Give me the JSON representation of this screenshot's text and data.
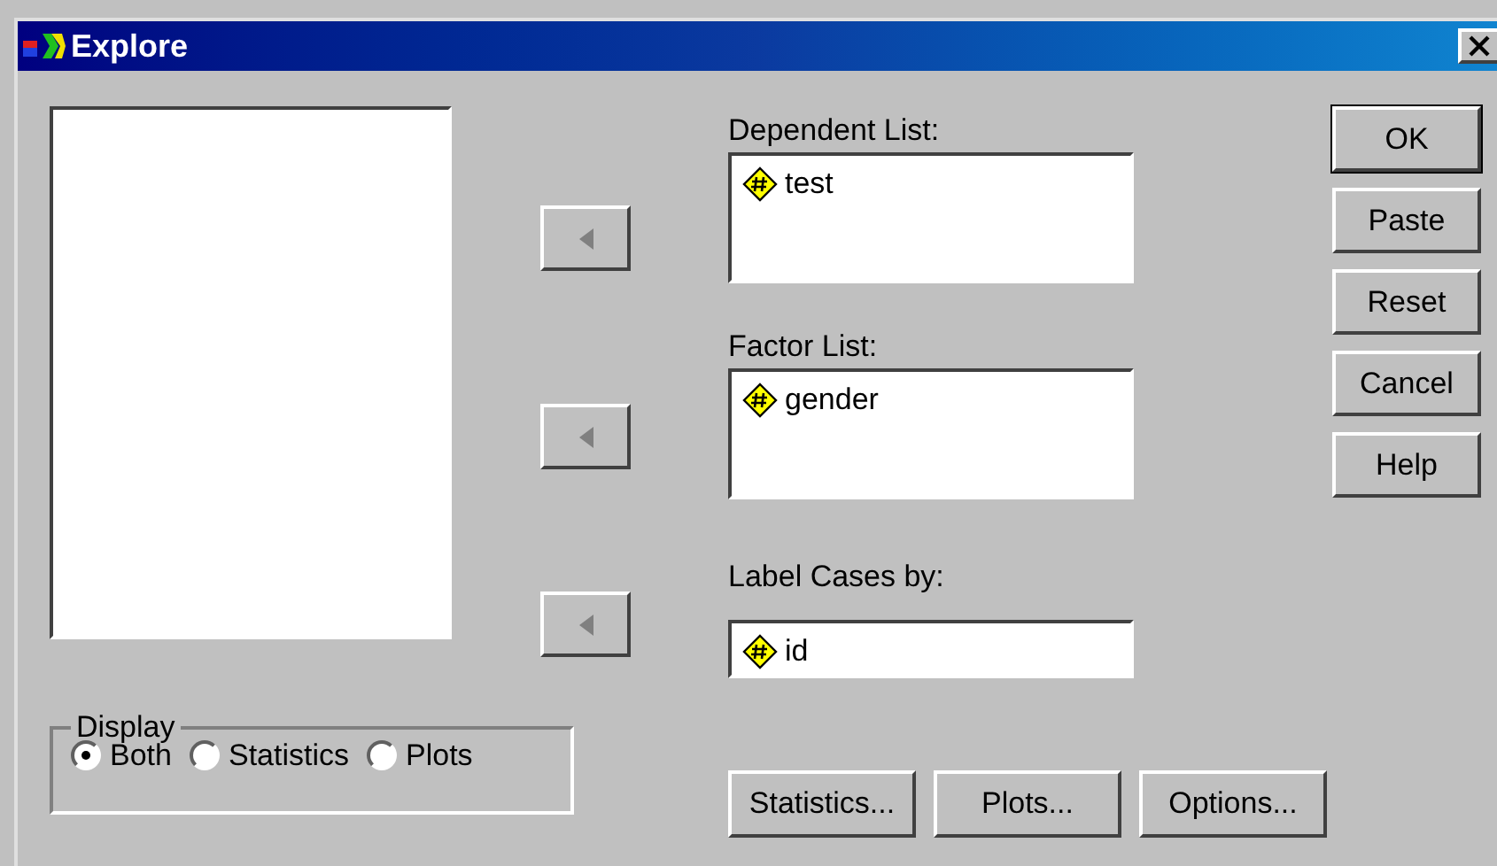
{
  "window": {
    "title": "Explore"
  },
  "variable_boxes": [
    {
      "kind": "list",
      "label": "Dependent List:",
      "items": [
        "test"
      ]
    },
    {
      "kind": "list",
      "label": "Factor List:",
      "items": [
        "gender"
      ]
    },
    {
      "kind": "field",
      "label": "Label Cases by:",
      "items": [
        "id"
      ]
    }
  ],
  "buttons": [
    {
      "label": "OK",
      "default": true
    },
    {
      "label": "Paste",
      "default": false
    },
    {
      "label": "Reset",
      "default": false
    },
    {
      "label": "Cancel",
      "default": false
    },
    {
      "label": "Help",
      "default": false
    }
  ],
  "display": {
    "title": "Display",
    "options": [
      {
        "label": "Both",
        "selected": true
      },
      {
        "label": "Statistics",
        "selected": false
      },
      {
        "label": "Plots",
        "selected": false
      }
    ]
  },
  "bottom_buttons": [
    "Statistics...",
    "Plots...",
    "Options..."
  ]
}
